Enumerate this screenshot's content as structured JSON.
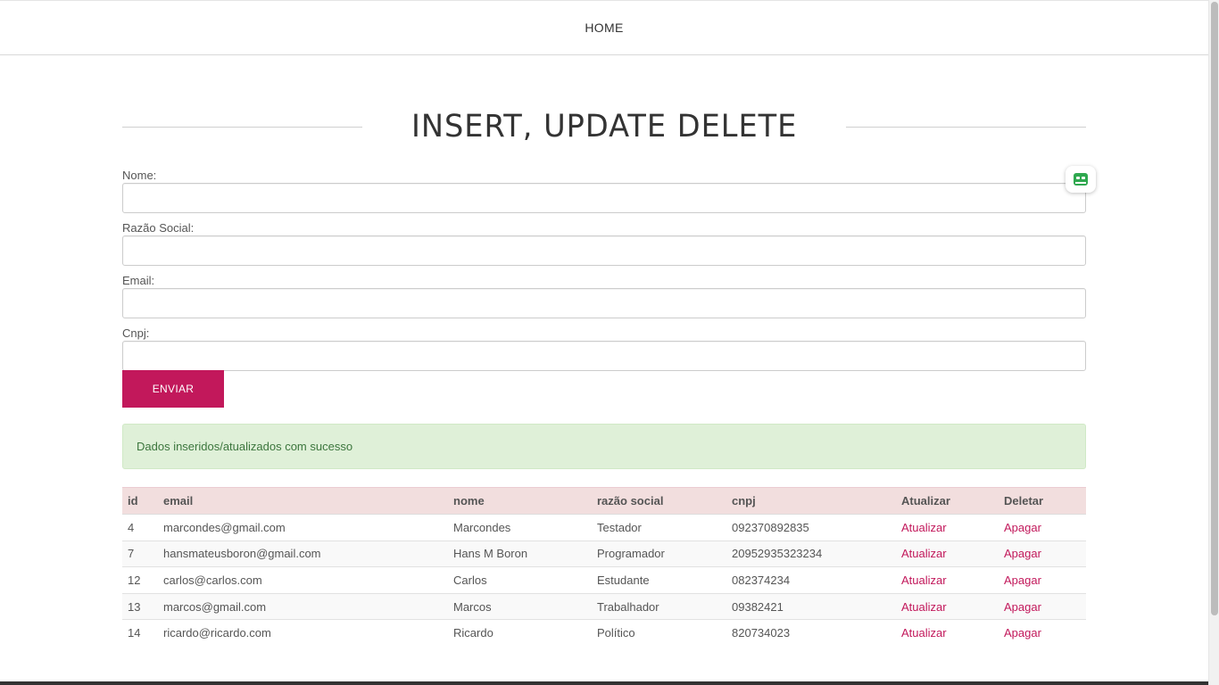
{
  "nav": {
    "home": "HOME"
  },
  "page": {
    "title": "INSERT, UPDATE DELETE"
  },
  "form": {
    "fields": [
      {
        "label": "Nome:",
        "value": ""
      },
      {
        "label": "Razão Social:",
        "value": ""
      },
      {
        "label": "Email:",
        "value": ""
      },
      {
        "label": "Cnpj:",
        "value": ""
      }
    ],
    "submit_label": "ENVIAR"
  },
  "alert": {
    "text": "Dados inseridos/atualizados com sucesso"
  },
  "table": {
    "headers": [
      "id",
      "email",
      "nome",
      "razão social",
      "cnpj",
      "Atualizar",
      "Deletar"
    ],
    "rows": [
      {
        "id": "4",
        "email": "marcondes@gmail.com",
        "nome": "Marcondes",
        "razao": "Testador",
        "cnpj": "092370892835",
        "update": "Atualizar",
        "delete": "Apagar"
      },
      {
        "id": "7",
        "email": "hansmateusboron@gmail.com",
        "nome": "Hans M Boron",
        "razao": "Programador",
        "cnpj": "20952935323234",
        "update": "Atualizar",
        "delete": "Apagar"
      },
      {
        "id": "12",
        "email": "carlos@carlos.com",
        "nome": "Carlos",
        "razao": "Estudante",
        "cnpj": "082374234",
        "update": "Atualizar",
        "delete": "Apagar"
      },
      {
        "id": "13",
        "email": "marcos@gmail.com",
        "nome": "Marcos",
        "razao": "Trabalhador",
        "cnpj": "09382421",
        "update": "Atualizar",
        "delete": "Apagar"
      },
      {
        "id": "14",
        "email": "ricardo@ricardo.com",
        "nome": "Ricardo",
        "razao": "Político",
        "cnpj": "820734023",
        "update": "Atualizar",
        "delete": "Apagar"
      }
    ]
  },
  "widget": {
    "icon": "robot-icon"
  },
  "colors": {
    "accent": "#c2185b",
    "alert_bg": "#dff0d8",
    "alert_text": "#3c763d",
    "table_header_bg": "#f2dede"
  }
}
